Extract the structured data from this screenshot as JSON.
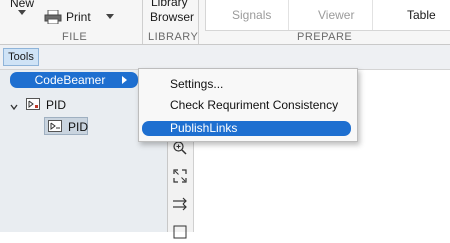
{
  "ribbon": {
    "new_label": "New",
    "print_label": "Print",
    "file_group": "FILE",
    "library_browser_line1": "Library",
    "library_browser_line2": "Browser",
    "library_group": "LIBRARY",
    "log_signals_line2": "Signals",
    "viewer_line2": "Viewer",
    "signal_table_line2": "Table",
    "prepare_group": "PREPARE"
  },
  "toolstrip": {
    "tools_label": "Tools"
  },
  "submenu": {
    "codebeamer_label": "CodeBeamer"
  },
  "menu": {
    "items": [
      {
        "label": "Settings..."
      },
      {
        "label": "Check Requriment Consistency"
      },
      {
        "label": "PublishLinks"
      }
    ]
  },
  "tree": {
    "root_label": "PID",
    "child_label": "PID"
  },
  "colors": {
    "highlight": "#1e6fd0",
    "pane_bg": "#e9edf1"
  }
}
